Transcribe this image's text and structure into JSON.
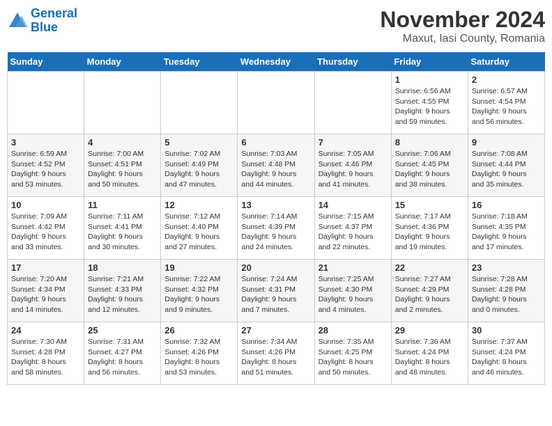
{
  "logo": {
    "line1": "General",
    "line2": "Blue"
  },
  "title": "November 2024",
  "subtitle": "Maxut, Iasi County, Romania",
  "weekdays": [
    "Sunday",
    "Monday",
    "Tuesday",
    "Wednesday",
    "Thursday",
    "Friday",
    "Saturday"
  ],
  "weeks": [
    [
      {
        "day": "",
        "info": ""
      },
      {
        "day": "",
        "info": ""
      },
      {
        "day": "",
        "info": ""
      },
      {
        "day": "",
        "info": ""
      },
      {
        "day": "",
        "info": ""
      },
      {
        "day": "1",
        "info": "Sunrise: 6:56 AM\nSunset: 4:55 PM\nDaylight: 9 hours and 59 minutes."
      },
      {
        "day": "2",
        "info": "Sunrise: 6:57 AM\nSunset: 4:54 PM\nDaylight: 9 hours and 56 minutes."
      }
    ],
    [
      {
        "day": "3",
        "info": "Sunrise: 6:59 AM\nSunset: 4:52 PM\nDaylight: 9 hours and 53 minutes."
      },
      {
        "day": "4",
        "info": "Sunrise: 7:00 AM\nSunset: 4:51 PM\nDaylight: 9 hours and 50 minutes."
      },
      {
        "day": "5",
        "info": "Sunrise: 7:02 AM\nSunset: 4:49 PM\nDaylight: 9 hours and 47 minutes."
      },
      {
        "day": "6",
        "info": "Sunrise: 7:03 AM\nSunset: 4:48 PM\nDaylight: 9 hours and 44 minutes."
      },
      {
        "day": "7",
        "info": "Sunrise: 7:05 AM\nSunset: 4:46 PM\nDaylight: 9 hours and 41 minutes."
      },
      {
        "day": "8",
        "info": "Sunrise: 7:06 AM\nSunset: 4:45 PM\nDaylight: 9 hours and 38 minutes."
      },
      {
        "day": "9",
        "info": "Sunrise: 7:08 AM\nSunset: 4:44 PM\nDaylight: 9 hours and 35 minutes."
      }
    ],
    [
      {
        "day": "10",
        "info": "Sunrise: 7:09 AM\nSunset: 4:42 PM\nDaylight: 9 hours and 33 minutes."
      },
      {
        "day": "11",
        "info": "Sunrise: 7:11 AM\nSunset: 4:41 PM\nDaylight: 9 hours and 30 minutes."
      },
      {
        "day": "12",
        "info": "Sunrise: 7:12 AM\nSunset: 4:40 PM\nDaylight: 9 hours and 27 minutes."
      },
      {
        "day": "13",
        "info": "Sunrise: 7:14 AM\nSunset: 4:39 PM\nDaylight: 9 hours and 24 minutes."
      },
      {
        "day": "14",
        "info": "Sunrise: 7:15 AM\nSunset: 4:37 PM\nDaylight: 9 hours and 22 minutes."
      },
      {
        "day": "15",
        "info": "Sunrise: 7:17 AM\nSunset: 4:36 PM\nDaylight: 9 hours and 19 minutes."
      },
      {
        "day": "16",
        "info": "Sunrise: 7:18 AM\nSunset: 4:35 PM\nDaylight: 9 hours and 17 minutes."
      }
    ],
    [
      {
        "day": "17",
        "info": "Sunrise: 7:20 AM\nSunset: 4:34 PM\nDaylight: 9 hours and 14 minutes."
      },
      {
        "day": "18",
        "info": "Sunrise: 7:21 AM\nSunset: 4:33 PM\nDaylight: 9 hours and 12 minutes."
      },
      {
        "day": "19",
        "info": "Sunrise: 7:22 AM\nSunset: 4:32 PM\nDaylight: 9 hours and 9 minutes."
      },
      {
        "day": "20",
        "info": "Sunrise: 7:24 AM\nSunset: 4:31 PM\nDaylight: 9 hours and 7 minutes."
      },
      {
        "day": "21",
        "info": "Sunrise: 7:25 AM\nSunset: 4:30 PM\nDaylight: 9 hours and 4 minutes."
      },
      {
        "day": "22",
        "info": "Sunrise: 7:27 AM\nSunset: 4:29 PM\nDaylight: 9 hours and 2 minutes."
      },
      {
        "day": "23",
        "info": "Sunrise: 7:28 AM\nSunset: 4:28 PM\nDaylight: 9 hours and 0 minutes."
      }
    ],
    [
      {
        "day": "24",
        "info": "Sunrise: 7:30 AM\nSunset: 4:28 PM\nDaylight: 8 hours and 58 minutes."
      },
      {
        "day": "25",
        "info": "Sunrise: 7:31 AM\nSunset: 4:27 PM\nDaylight: 8 hours and 56 minutes."
      },
      {
        "day": "26",
        "info": "Sunrise: 7:32 AM\nSunset: 4:26 PM\nDaylight: 8 hours and 53 minutes."
      },
      {
        "day": "27",
        "info": "Sunrise: 7:34 AM\nSunset: 4:26 PM\nDaylight: 8 hours and 51 minutes."
      },
      {
        "day": "28",
        "info": "Sunrise: 7:35 AM\nSunset: 4:25 PM\nDaylight: 8 hours and 50 minutes."
      },
      {
        "day": "29",
        "info": "Sunrise: 7:36 AM\nSunset: 4:24 PM\nDaylight: 8 hours and 48 minutes."
      },
      {
        "day": "30",
        "info": "Sunrise: 7:37 AM\nSunset: 4:24 PM\nDaylight: 8 hours and 46 minutes."
      }
    ]
  ]
}
